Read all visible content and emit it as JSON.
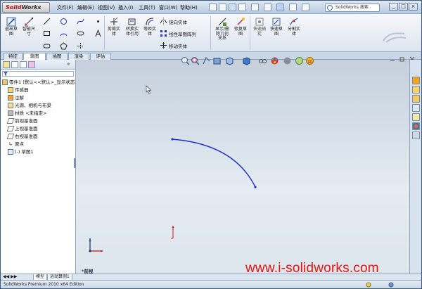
{
  "app": {
    "logo_brand": "Solid",
    "logo_rest": "Works",
    "menus": [
      "文件(F)",
      "编辑(E)",
      "视图(V)",
      "插入(I)",
      "工具(T)",
      "窗口(W)",
      "帮助(H)"
    ],
    "search_placeholder": "SolidWorks 搜索",
    "window_buttons": [
      "_",
      "□",
      "×"
    ]
  },
  "ribbon": {
    "big_buttons": [
      {
        "label": "退出草\n图"
      },
      {
        "label": "智能尺\n寸"
      },
      {
        "label": "剪裁实\n体"
      },
      {
        "label": "转换实\n体引用"
      },
      {
        "label": "等距实\n体"
      },
      {
        "label": "显示/删\n除几何\n关系"
      },
      {
        "label": "修复草\n图"
      },
      {
        "label": "快速捕\n捉"
      },
      {
        "label": "快速草\n图"
      },
      {
        "label": "分割实\n体"
      }
    ],
    "small_labels": {
      "mirror": "镜向实体",
      "linear_pattern": "线性草图阵列",
      "move": "移动实体"
    }
  },
  "tabs": [
    "特征",
    "草图",
    "评估",
    "DimXpert",
    "办公室产品"
  ],
  "tabs_visible": [
    "特征",
    "草图",
    "插图",
    "渲染",
    "评估"
  ],
  "tree": {
    "root": "零件1  (默认<<默认>_显示状态",
    "items": [
      "传感器",
      "注解",
      "光源、相机与布景",
      "材质 <未指定>",
      "前视基准面",
      "上视基准面",
      "右视基准面",
      "原点",
      "(-) 草图1"
    ]
  },
  "view": {
    "label": "*前视"
  },
  "bottom_tabs": [
    "模型",
    "运动算例1"
  ],
  "status": {
    "text": "SolidWorks Premium 2010 x64 Edition"
  },
  "watermark": "www.i-solidworks.com",
  "colors": {
    "accent_blue": "#1c2fd6",
    "origin_red": "#d9141a",
    "watermark_red": "#e8130f"
  }
}
